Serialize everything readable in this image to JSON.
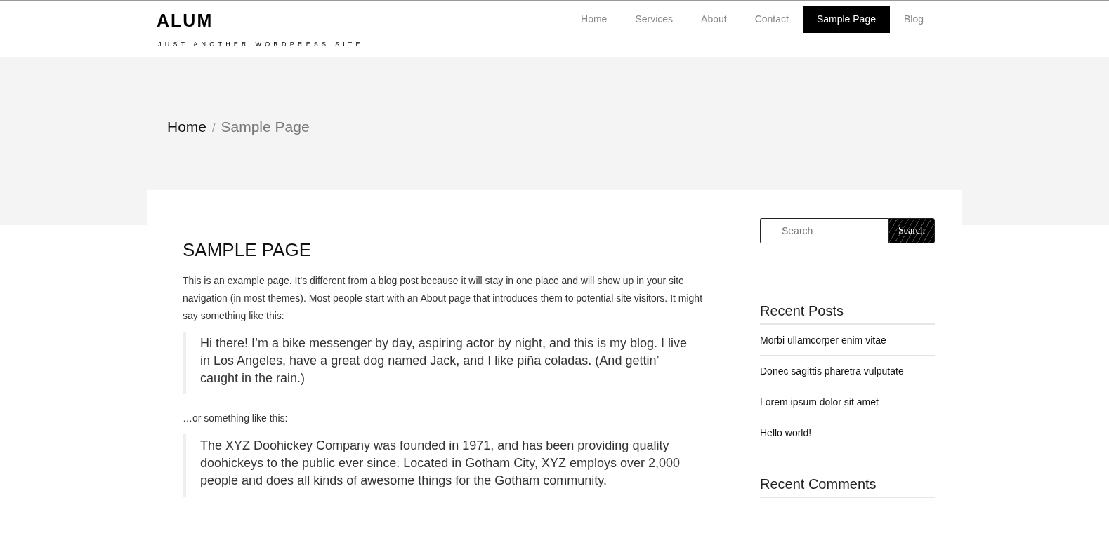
{
  "site": {
    "title": "ALUM",
    "tagline": "JUST ANOTHER WORDPRESS SITE"
  },
  "nav": [
    {
      "label": "Home",
      "selected": false
    },
    {
      "label": "Services",
      "selected": false
    },
    {
      "label": "About",
      "selected": false
    },
    {
      "label": "Contact",
      "selected": false
    },
    {
      "label": "Sample Page",
      "selected": true
    },
    {
      "label": "Blog",
      "selected": false
    }
  ],
  "breadcrumb": [
    {
      "label": "Home",
      "kind": "link"
    },
    {
      "label": "/",
      "kind": "separator"
    },
    {
      "label": "Sample Page",
      "kind": "current"
    }
  ],
  "article": {
    "title": "SAMPLE PAGE",
    "blocks": [
      {
        "kind": "paragraph",
        "text": "This is an example page. It’s different from a blog post because it will stay in one place and will show up in your site navigation (in most themes). Most people start with an About page that introduces them to potential site visitors. It might say something like this:"
      },
      {
        "kind": "quote",
        "text": "Hi there! I’m a bike messenger by day, aspiring actor by night, and this is my blog. I live in Los Angeles, have a great dog named Jack, and I like piña coladas. (And gettin’ caught in the rain.)"
      },
      {
        "kind": "paragraph",
        "text": "…or something like this:"
      },
      {
        "kind": "quote",
        "text": "The XYZ Doohickey Company was founded in 1971, and has been providing quality doohickeys to the public ever since. Located in Gotham City, XYZ employs over 2,000 people and does all kinds of awesome things for the Gotham community."
      }
    ]
  },
  "sidebar": {
    "search": {
      "placeholder": "Search",
      "button": "Search"
    },
    "widgets": [
      {
        "title": "Recent Posts",
        "items": [
          "Morbi ullamcorper enim vitae",
          "Donec sagittis pharetra vulputate",
          "Lorem ipsum dolor sit amet",
          "Hello world!"
        ]
      },
      {
        "title": "Recent Comments"
      }
    ]
  }
}
